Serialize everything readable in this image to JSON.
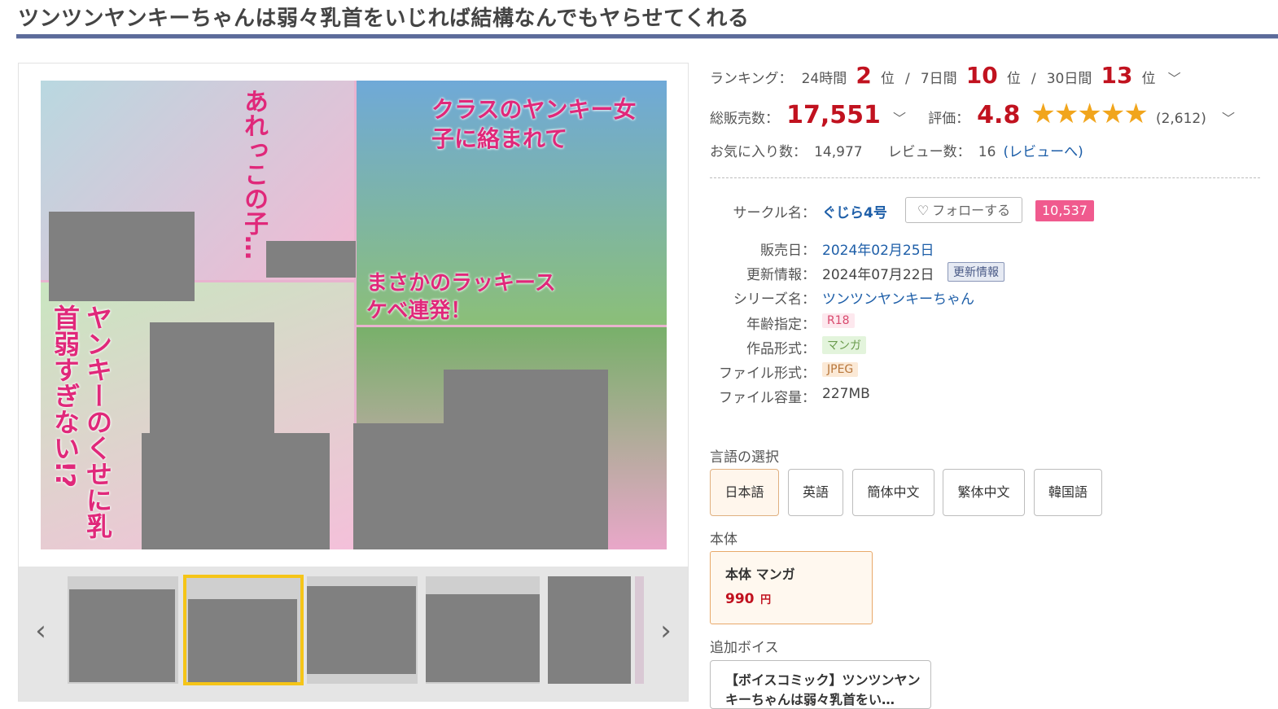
{
  "title": "ツンツンヤンキーちゃんは弱々乳首をいじれば結構なんでもヤらせてくれる",
  "ranking": {
    "label": "ランキング：",
    "periods": [
      {
        "label": "24時間",
        "rank": "2",
        "unit": "位"
      },
      {
        "label": "7日間",
        "rank": "10",
        "unit": "位"
      },
      {
        "label": "30日間",
        "rank": "13",
        "unit": "位"
      }
    ],
    "separator": "/"
  },
  "sales": {
    "label": "総販売数：",
    "value": "17,551"
  },
  "rating": {
    "label": "評価：",
    "value": "4.8",
    "stars": 5,
    "count": "(2,612)"
  },
  "favorites": {
    "label": "お気に入り数：",
    "value": "14,977"
  },
  "reviews": {
    "label": "レビュー数：",
    "value": "16",
    "link": "(レビューへ)"
  },
  "circle": {
    "label": "サークル名：",
    "name": "ぐじら4号",
    "follow_label": "フォローする",
    "follow_count": "10,537"
  },
  "specs": {
    "release_label": "販売日：",
    "release": "2024年02月25日",
    "update_label": "更新情報：",
    "update": "2024年07月22日",
    "update_tag": "更新情報",
    "series_label": "シリーズ名：",
    "series": "ツンツンヤンキーちゃん",
    "age_label": "年齢指定：",
    "age": "R18",
    "format_label": "作品形式：",
    "format": "マンガ",
    "file_label": "ファイル形式：",
    "file": "JPEG",
    "size_label": "ファイル容量：",
    "size": "227MB"
  },
  "language": {
    "label": "言語の選択",
    "options": [
      "日本語",
      "英語",
      "簡体中文",
      "繁体中文",
      "韓国語"
    ],
    "selected": "日本語"
  },
  "edition": {
    "label": "本体",
    "name": "本体 マンガ",
    "price": "990",
    "price_unit": "円"
  },
  "voice": {
    "label": "追加ボイス",
    "title": "【ボイスコミック】ツンツンヤンキーちゃんは弱々乳首をい…"
  },
  "cover_text": {
    "t1": "あれっこの子…",
    "t2": "クラスのヤンキー女子に絡まれて",
    "t3": "まさかのラッキースケベ連発！",
    "t4": "ヤンキーのくせに乳首弱すぎない!?"
  },
  "colors": {
    "accent_red": "#c1121f",
    "link_blue": "#1d5ea8",
    "star": "#f1a51c",
    "follow_pink": "#f05a8e",
    "thumb_active": "#f5c518"
  }
}
